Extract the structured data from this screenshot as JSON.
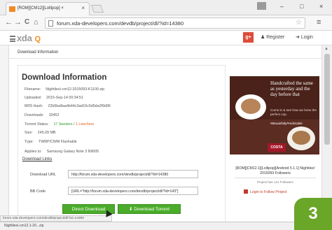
{
  "browser": {
    "tab_title": "[ROM][CM12][Lollipop] ×",
    "tab_close": "×",
    "url": "forum.xda-developers.com/devdb/project/dl/?id=14380",
    "window_controls": {
      "minimize": "–",
      "maximize": "□",
      "close": "×"
    },
    "nav": {
      "back": "←",
      "forward": "→",
      "reload": "C",
      "home": "⌂",
      "menu": "≡"
    }
  },
  "site": {
    "logo_prefix": "xda",
    "search_glyph": "Q",
    "gplus": "g+",
    "register": "Register",
    "login": "Login"
  },
  "page": {
    "section_title": "Download Information",
    "heading": "Download Information",
    "info": [
      {
        "label": "Filename",
        "value": "Nightlies\\-cm12-2015093-K1100.zip"
      },
      {
        "label": "Uploaded",
        "value": "2015-Sep-14 00:34:51"
      },
      {
        "label": "MD5 Hash",
        "value": "22b5ba8aa4b44c3ad16c5d5da2f9d96"
      },
      {
        "label": "Downloads",
        "value": "33452"
      },
      {
        "label": "Torrent Status",
        "seeders": "17 Seeders",
        "leechers": "1 Leechers"
      },
      {
        "label": "Size",
        "value": "245.09 MB"
      },
      {
        "label": "Type",
        "value": "TWRP/CWM Flashable"
      },
      {
        "label": "Applies to",
        "value": "Samsung Galaxy Note 3 N9005"
      }
    ],
    "download_links_label": "Download Links",
    "fields": [
      {
        "label": "Download URL",
        "value": "http://forum.xda-developers.com/devdb/project/dl/?id=14380"
      },
      {
        "label": "BB Code",
        "value": "[URL=\"http://forum.xda-developers.com/devdb/project/dl/?id=143\"]"
      }
    ],
    "buttons": {
      "direct": "Direct Download",
      "torrent": "Download Torrent",
      "torrent_icon": "⬇"
    }
  },
  "sidebar": {
    "ad": {
      "headline": "Handcrafted the same as yesterday and the day before that",
      "body": "Come in & see how we brew the perfect cup.",
      "tag": "#BeautifullyPredictable",
      "brand": "COSTA"
    },
    "project_name": "[ROM][CM12.1][Lollipop][Android 5.1.1] Nightlies! 2015093 Followers",
    "followers": "Project has 141 Followers",
    "login_follow": "Login to Follow Project"
  },
  "status": {
    "hover_url": "forum.xda-developers.com/devdb/project/dl/?id=14380",
    "download_item": "Nightlies\\-cm12.1-20...zip"
  },
  "badge": "3"
}
